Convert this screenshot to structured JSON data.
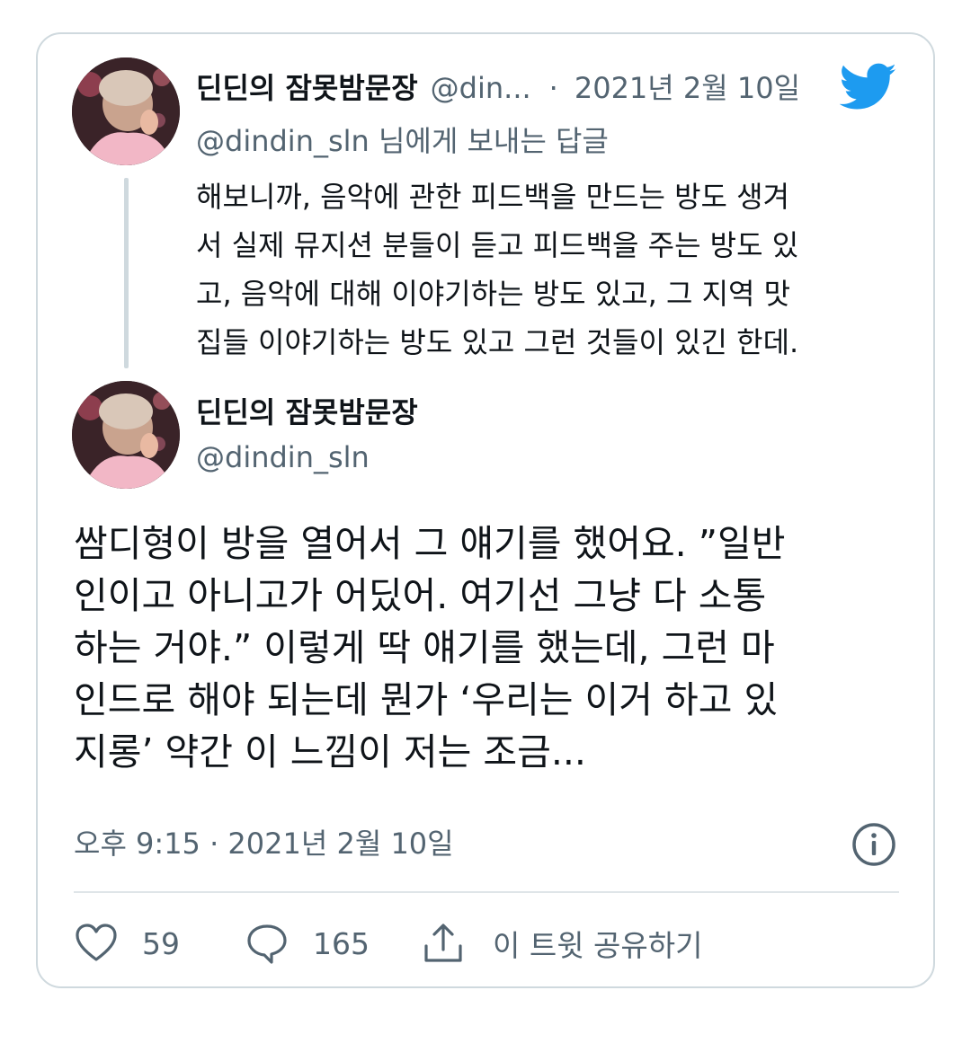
{
  "reply_tweet": {
    "author_name": "딘딘의 잠못밤문장",
    "author_handle": "@din...",
    "separator": "·",
    "date": "2021년 2월 10일",
    "replying_to": "@dindin_sln 님에게 보내는 답글",
    "text_lines": [
      "해보니까, 음악에 관한 피드백을 만드는 방도 생겨",
      "서 실제 뮤지션 분들이 듣고 피드백을 주는 방도 있",
      "고, 음악에 대해 이야기하는 방도 있고, 그 지역 맛",
      "집들 이야기하는 방도 있고 그런 것들이 있긴 한데."
    ]
  },
  "main_tweet": {
    "author_name": "딘딘의 잠못밤문장",
    "author_handle": "@dindin_sln",
    "text_lines": [
      "쌈디형이 방을 열어서 그 얘기를 했어요. ”일반",
      "인이고 아니고가 어딨어. 여기선 그냥 다 소통",
      "하는 거야.” 이렇게 딱 얘기를 했는데, 그런 마",
      "인드로 해야 되는데 뭔가 ‘우리는 이거 하고 있",
      "지롱’ 약간 이 느낌이 저는 조금..."
    ],
    "timestamp": "오후 9:15 · 2021년 2월 10일"
  },
  "actions": {
    "likes": "59",
    "replies": "165",
    "share_label": "이 트윗 공유하기"
  },
  "icons": {
    "logo": "twitter-bird-icon",
    "info": "info-icon",
    "like": "heart-icon",
    "reply": "comment-bubble-icon",
    "share": "share-upload-icon"
  },
  "colors": {
    "brand": "#1d9bf0",
    "secondary_text": "#536471",
    "border": "#cfd9de"
  }
}
